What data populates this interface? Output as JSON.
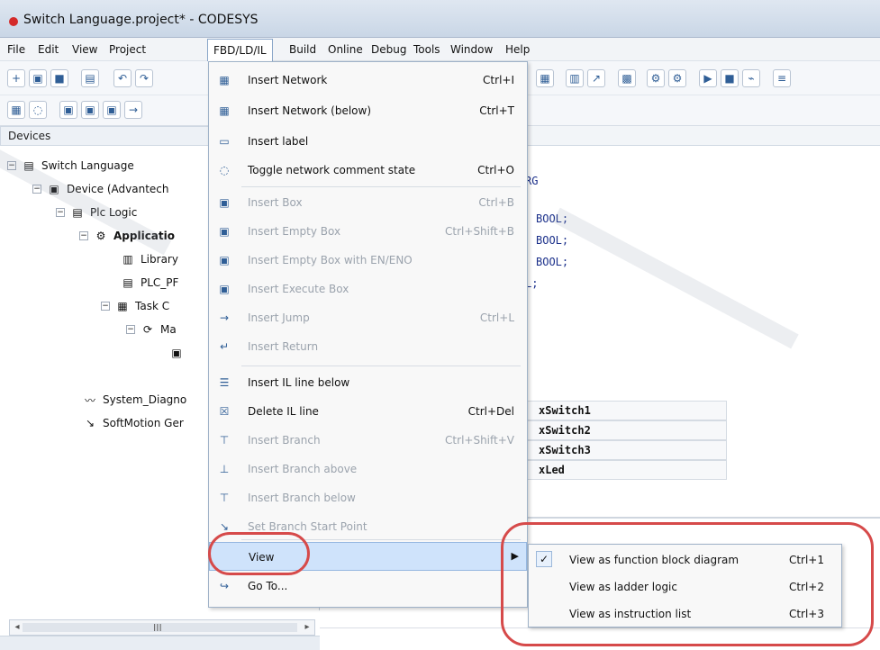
{
  "window": {
    "title": "Switch Language.project* - CODESYS",
    "title_dot_color": "#d42a2a"
  },
  "menubar": {
    "items": [
      "File",
      "Edit",
      "View",
      "Project",
      "FBD/LD/IL",
      "Build",
      "Online",
      "Debug",
      "Tools",
      "Window",
      "Help"
    ]
  },
  "devices": {
    "header": "Devices",
    "tree": [
      {
        "label": "Switch Language",
        "icon": "project-icon"
      },
      {
        "label": "Device (Advantech",
        "icon": "device-icon"
      },
      {
        "label": "Plc Logic",
        "icon": "plc-logic-icon"
      },
      {
        "label": "Applicatio",
        "icon": "application-icon"
      },
      {
        "label": "Library",
        "icon": "library-icon"
      },
      {
        "label": "PLC_PF",
        "icon": "program-icon"
      },
      {
        "label": "Task C",
        "icon": "task-config-icon"
      },
      {
        "label": "Ma",
        "icon": "task-icon"
      },
      {
        "label": "",
        "icon": "pou-icon"
      },
      {
        "label": "System_Diagno",
        "icon": "diagnostics-icon"
      },
      {
        "label": "SoftMotion Ger",
        "icon": "softmotion-icon"
      }
    ],
    "scroll_glyph": "III"
  },
  "editor": {
    "code": [
      "RG",
      "BOOL;",
      "BOOL;",
      "BOOL;",
      "L;"
    ],
    "vars": [
      "xSwitch1",
      "xSwitch2",
      "xSwitch3",
      "xLed"
    ]
  },
  "dropdown": {
    "items": [
      {
        "label": "Insert Network",
        "shortcut": "Ctrl+I",
        "enabled": true,
        "icon": "insert-network-icon"
      },
      {
        "label": "Insert Network (below)",
        "shortcut": "Ctrl+T",
        "enabled": true,
        "icon": "insert-network-below-icon"
      },
      {
        "label": "Insert label",
        "shortcut": "",
        "enabled": true,
        "icon": "insert-label-icon"
      },
      {
        "label": "Toggle network comment state",
        "shortcut": "Ctrl+O",
        "enabled": true,
        "icon": "toggle-comment-icon"
      },
      {
        "label": "Insert Box",
        "shortcut": "Ctrl+B",
        "enabled": false,
        "icon": "insert-box-icon"
      },
      {
        "label": "Insert Empty Box",
        "shortcut": "Ctrl+Shift+B",
        "enabled": false,
        "icon": "insert-empty-box-icon"
      },
      {
        "label": "Insert Empty Box with EN/ENO",
        "shortcut": "",
        "enabled": false,
        "icon": "insert-empty-box-en-eno-icon"
      },
      {
        "label": "Insert Execute Box",
        "shortcut": "",
        "enabled": false,
        "icon": "insert-execute-box-icon"
      },
      {
        "label": "Insert Jump",
        "shortcut": "Ctrl+L",
        "enabled": false,
        "icon": "insert-jump-icon"
      },
      {
        "label": "Insert Return",
        "shortcut": "",
        "enabled": false,
        "icon": "insert-return-icon"
      },
      {
        "label": "Insert IL line below",
        "shortcut": "",
        "enabled": true,
        "icon": "insert-il-line-icon"
      },
      {
        "label": "Delete IL line",
        "shortcut": "Ctrl+Del",
        "enabled": true,
        "icon": "delete-il-line-icon"
      },
      {
        "label": "Insert Branch",
        "shortcut": "Ctrl+Shift+V",
        "enabled": false,
        "icon": "insert-branch-icon"
      },
      {
        "label": "Insert Branch above",
        "shortcut": "",
        "enabled": false,
        "icon": "insert-branch-above-icon"
      },
      {
        "label": "Insert Branch below",
        "shortcut": "",
        "enabled": false,
        "icon": "insert-branch-below-icon"
      },
      {
        "label": "Set Branch Start Point",
        "shortcut": "",
        "enabled": false,
        "icon": "set-branch-start-icon"
      },
      {
        "label": "View",
        "shortcut": "",
        "enabled": true,
        "icon": "",
        "submenu": true
      },
      {
        "label": "Go To...",
        "shortcut": "",
        "enabled": true,
        "icon": "go-to-icon"
      }
    ]
  },
  "submenu": {
    "items": [
      {
        "label": "View as function block diagram",
        "shortcut": "Ctrl+1",
        "checked": true
      },
      {
        "label": "View as ladder logic",
        "shortcut": "Ctrl+2",
        "checked": false
      },
      {
        "label": "View as instruction list",
        "shortcut": "Ctrl+3",
        "checked": false
      }
    ]
  }
}
